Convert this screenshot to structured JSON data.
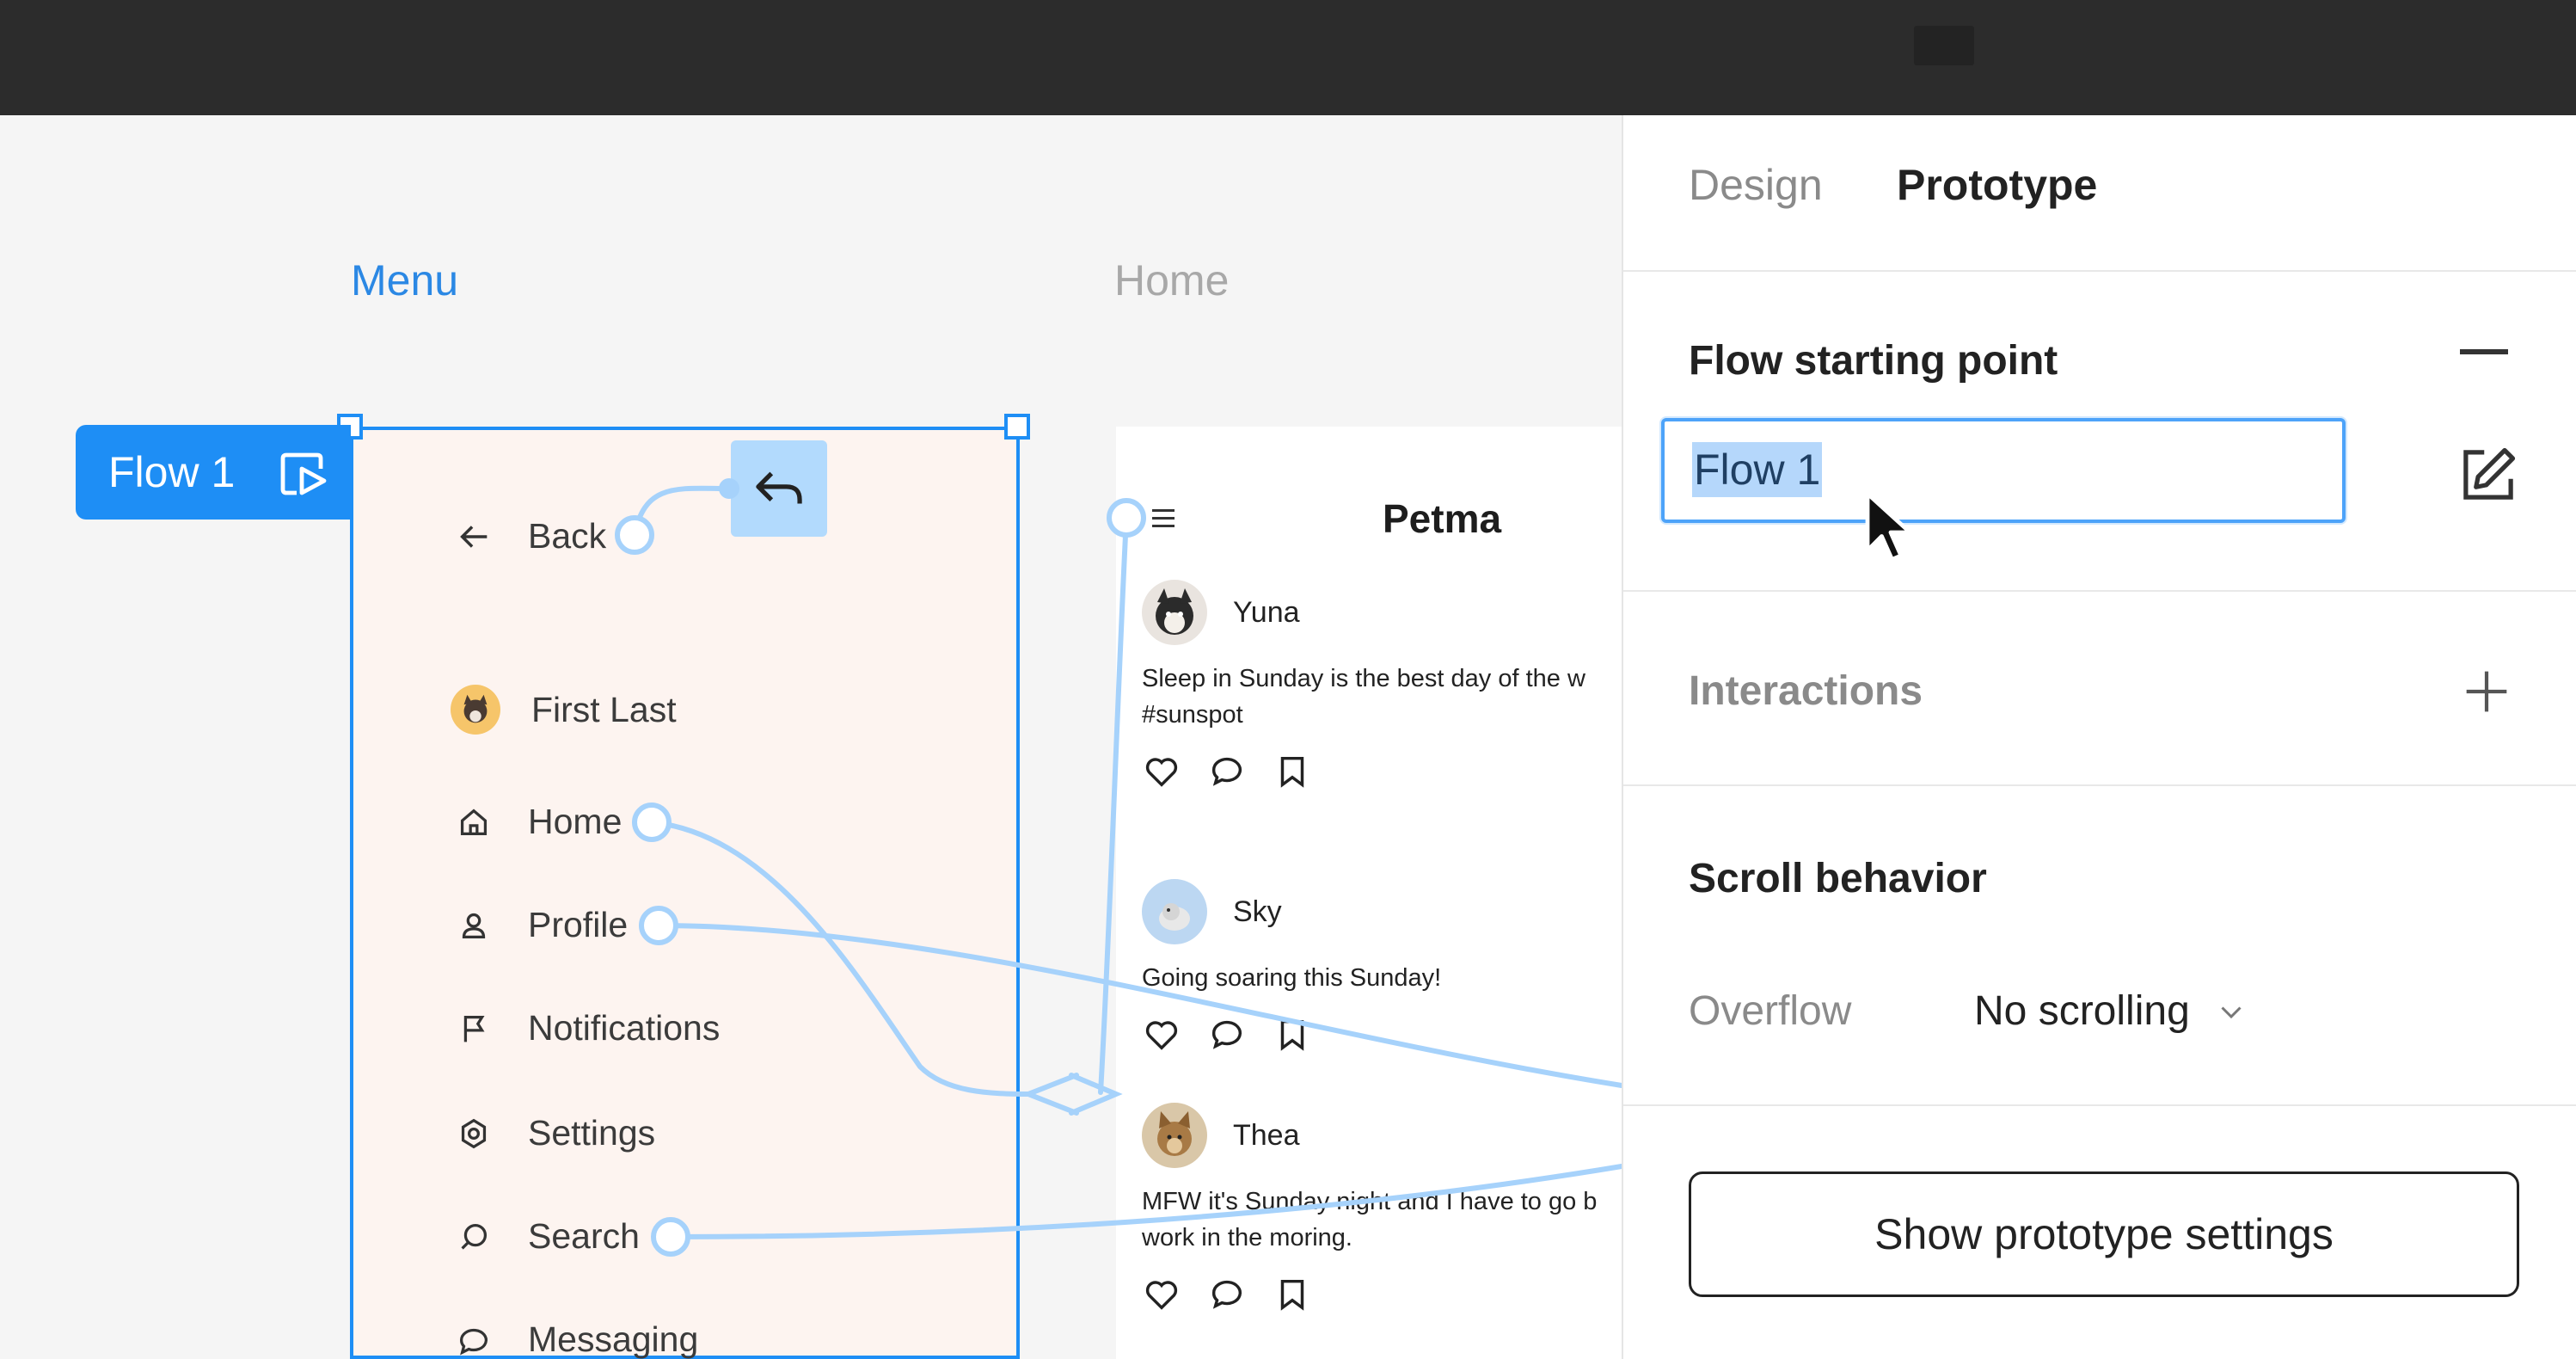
{
  "panel": {
    "tabs": [
      {
        "label": "Design",
        "active": false
      },
      {
        "label": "Prototype",
        "active": true
      }
    ],
    "flow_section": {
      "title": "Flow starting point",
      "input_value": "Flow 1"
    },
    "interactions_section": {
      "title": "Interactions"
    },
    "scroll_section": {
      "title": "Scroll behavior",
      "overflow_label": "Overflow",
      "overflow_value": "No scrolling"
    },
    "show_settings_button": "Show prototype settings"
  },
  "canvas": {
    "flow_badge": "Flow 1",
    "menu_frame": {
      "label": "Menu",
      "back_label": "Back",
      "user_name": "First Last",
      "items": [
        {
          "label": "Home",
          "icon": "home-icon"
        },
        {
          "label": "Profile",
          "icon": "person-icon"
        },
        {
          "label": "Notifications",
          "icon": "flag-icon"
        },
        {
          "label": "Settings",
          "icon": "gear-icon"
        },
        {
          "label": "Search",
          "icon": "search-icon"
        },
        {
          "label": "Messaging",
          "icon": "chat-bubble-icon"
        }
      ]
    },
    "home_frame": {
      "label": "Home",
      "app_title": "Petma",
      "posts": [
        {
          "name": "Yuna",
          "text": "Sleep in Sunday is the best day of the w\n#sunspot"
        },
        {
          "name": "Sky",
          "text": "Going soaring this Sunday!"
        },
        {
          "name": "Thea",
          "text": "MFW it's Sunday night and I have to go b\nwork in the moring."
        }
      ]
    }
  },
  "colors": {
    "selection_blue": "#1e8ef5",
    "connector_blue": "#a6d2fb",
    "topbar": "#2c2c2c",
    "canvas_bg": "#f5f5f5",
    "menu_bg": "#fdf4f0"
  }
}
